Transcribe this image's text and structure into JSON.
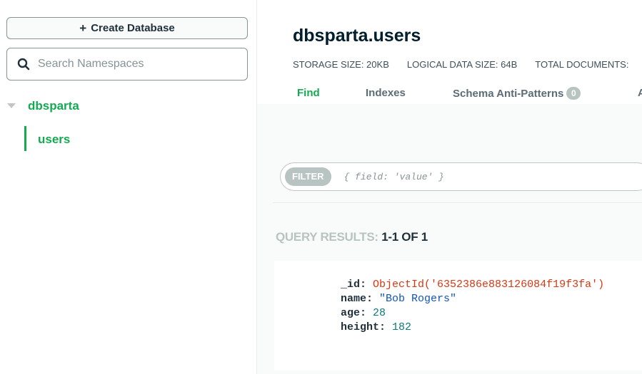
{
  "sidebar": {
    "create_button_label": "Create Database",
    "search_placeholder": "Search Namespaces",
    "database": "dbsparta",
    "collection": "users"
  },
  "main": {
    "title": "dbsparta.users",
    "stats": [
      "STORAGE SIZE: 20KB",
      "LOGICAL DATA SIZE: 64B",
      "TOTAL DOCUMENTS:"
    ],
    "tabs": {
      "find": "Find",
      "indexes": "Indexes",
      "schema": "Schema Anti-Patterns",
      "schema_count": "0",
      "cut_off": "A"
    },
    "filter": {
      "pill": "FILTER",
      "placeholder": "{ field: 'value' }"
    },
    "results": {
      "label": "QUERY RESULTS:",
      "count": "1-1 OF 1"
    },
    "document": {
      "id_key": "_id:",
      "id_value": "ObjectId('6352386e883126084f19f3fa')",
      "name_key": "name:",
      "name_value": "\"Bob Rogers\"",
      "age_key": "age:",
      "age_value": "28",
      "height_key": "height:",
      "height_value": "182"
    }
  },
  "colors": {
    "accent": "#13aa52",
    "object_id": "#d83713",
    "string": "#1254b7",
    "number": "#0c7a7a"
  }
}
